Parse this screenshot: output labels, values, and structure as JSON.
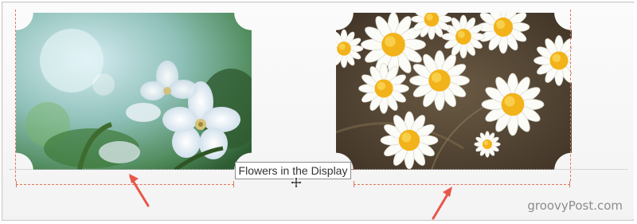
{
  "slide": {
    "caption_text": "Flowers in the Display",
    "left_image_icon": "apple-blossom-photo",
    "right_image_icon": "daisy-photo",
    "move_cursor_icon": "move-cursor-icon",
    "annotation_arrow_color": "#e8574a",
    "guide_color": "#e0755f"
  },
  "watermark": {
    "text": "groovyPost.com"
  }
}
